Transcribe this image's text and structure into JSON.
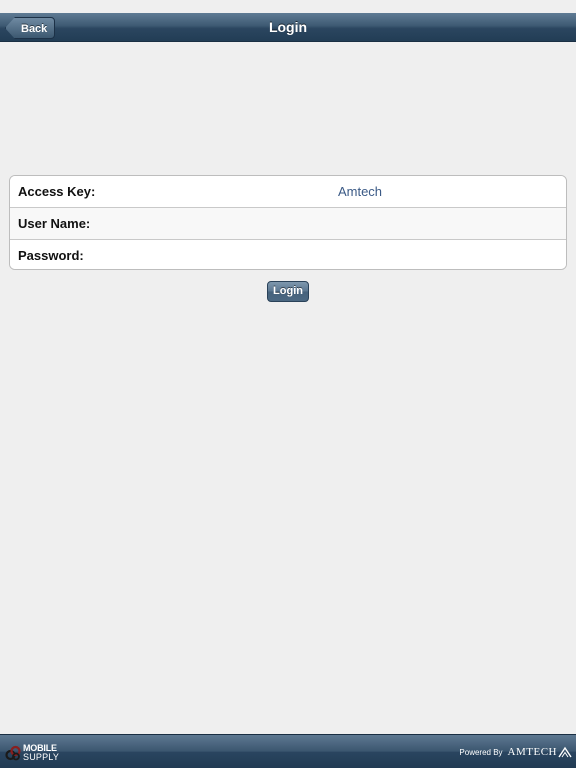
{
  "nav": {
    "back_label": "Back",
    "title": "Login"
  },
  "form": {
    "rows": [
      {
        "label": "Access Key:",
        "value": "Amtech",
        "placeholder": ""
      },
      {
        "label": "User Name:",
        "value": "",
        "placeholder": ""
      },
      {
        "label": "Password:",
        "value": "",
        "placeholder": ""
      }
    ]
  },
  "actions": {
    "login_label": "Login"
  },
  "footer": {
    "app_logo_line1": "MOBILE",
    "app_logo_line2": "SUPPLY",
    "app_logo_icon": "gear-icon",
    "powered_by": "Powered By",
    "brand": "AMTECH",
    "brand_icon": "amtech-logo-mark"
  },
  "colors": {
    "bar": "#2b4660",
    "background": "#efefef",
    "value_text": "#3b5a86",
    "button": "#5a7690"
  }
}
